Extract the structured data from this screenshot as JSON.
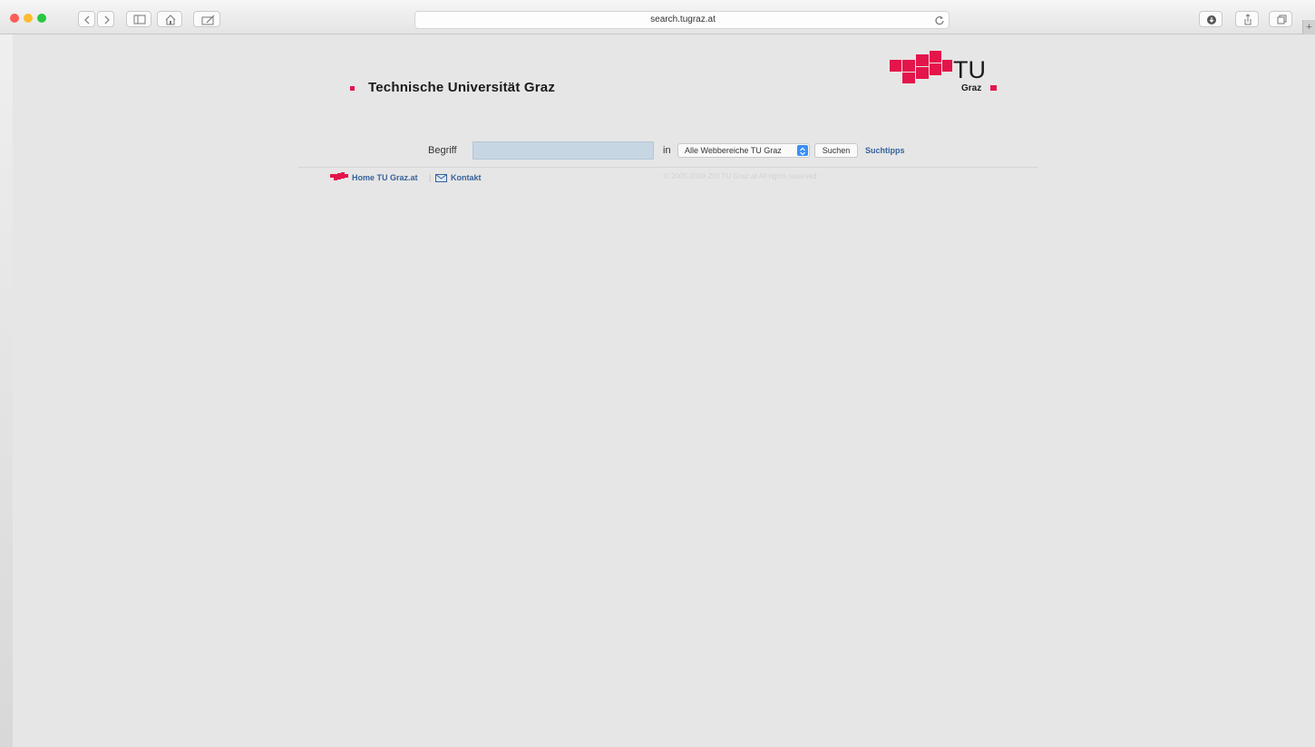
{
  "browser": {
    "address": "search.tugraz.at",
    "traffic_colors": {
      "close": "#fd5f57",
      "minimize": "#febc2e",
      "zoom": "#28c840"
    },
    "icons": [
      "back-icon",
      "forward-icon",
      "sidebar-icon",
      "home-icon",
      "edit-icon",
      "reload-icon",
      "download-icon",
      "share-icon",
      "tabs-icon",
      "plus-icon"
    ]
  },
  "page": {
    "brand_name": "Technische Universität Graz",
    "logo": {
      "tu": "TU",
      "graz": "Graz"
    },
    "search": {
      "label": "Begriff",
      "value": "",
      "in_label": "in",
      "scope_selected": "Alle Webbereiche TU Graz",
      "button_label": "Suchen",
      "tips_link": "Suchtipps"
    },
    "footer": {
      "home_link": "Home TU Graz.at",
      "separator": "|",
      "contact_link": "Kontakt",
      "copyright": "© 2005-2009 ZID TU Graz.at All rights reserved"
    },
    "colors": {
      "brand_red": "#e4154b",
      "link_blue": "#36639a",
      "input_fill": "#c7d6e3"
    }
  }
}
